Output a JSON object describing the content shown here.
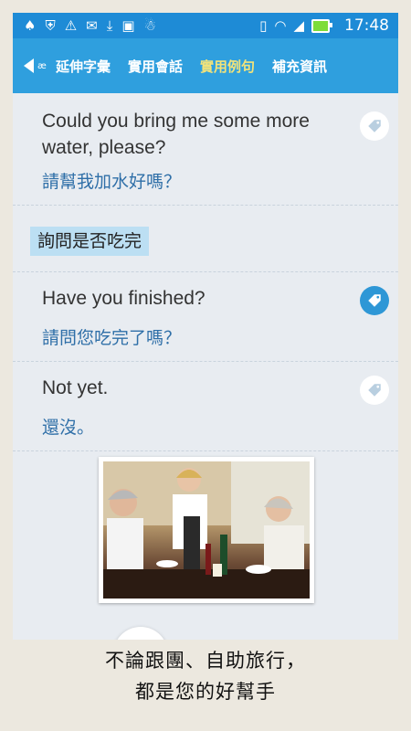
{
  "status_bar": {
    "time": "17:48",
    "left_icons": [
      "keyhole-icon",
      "shield-icon",
      "warning-icon",
      "chat-icon",
      "download-icon",
      "bag-icon",
      "android-icon"
    ],
    "right_icons": [
      "vibrate-icon",
      "wifi-icon",
      "signal-icon",
      "battery-charging-icon"
    ]
  },
  "app_bar": {
    "back_mark": "æ",
    "tabs": [
      {
        "label": "延伸字彙",
        "active": false
      },
      {
        "label": "實用會話",
        "active": false
      },
      {
        "label": "實用例句",
        "active": true
      },
      {
        "label": "補充資訊",
        "active": false
      }
    ]
  },
  "phrases": [
    {
      "en": "Could you bring me some more water, please?",
      "zh": "請幫我加水好嗎？",
      "tagged": false
    },
    {
      "section": "詢問是否吃完"
    },
    {
      "en": "Have you finished?",
      "zh": "請問您吃完了嗎？",
      "tagged": true
    },
    {
      "en": "Not yet.",
      "zh": "還沒。",
      "tagged": false
    }
  ],
  "footer": {
    "line1": "不論跟團、自助旅行，",
    "line2": "都是您的好幫手"
  },
  "colors": {
    "status_bar": "#1e8bd6",
    "app_bar": "#2f9fde",
    "active_tab": "#f2e37a",
    "chinese_text": "#2f6fa8",
    "section_highlight": "#bcdff3"
  }
}
